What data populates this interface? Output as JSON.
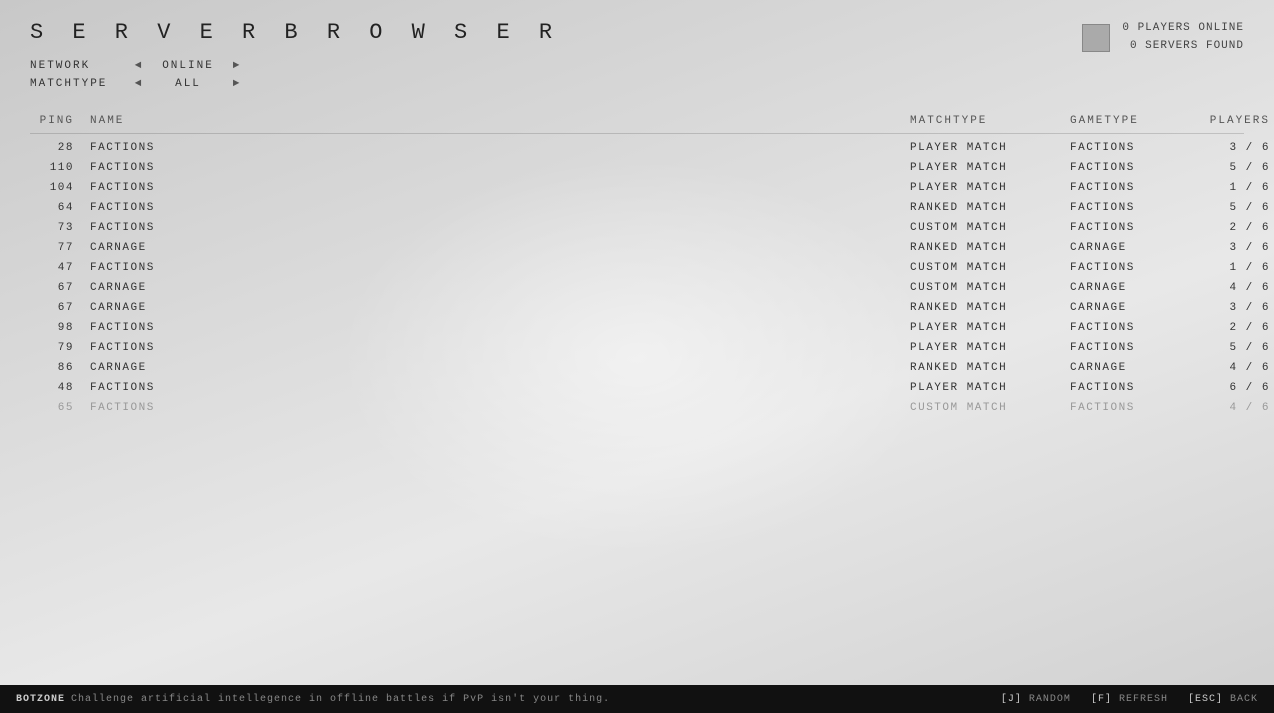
{
  "header": {
    "title": "S E R V E R   B R O W S E R",
    "server_icon_label": "server-icon",
    "players_online": "0 PLAYERS ONLINE",
    "servers_found": "0 SERVERS FOUND"
  },
  "filters": {
    "network_label": "NETWORK",
    "network_value": "ONLINE",
    "matchtype_label": "MATCHTYPE",
    "matchtype_value": "ALL"
  },
  "table": {
    "headers": {
      "ping": "PING",
      "name": "NAME",
      "matchtype": "MATCHTYPE",
      "gametype": "GAMETYPE",
      "players": "PLAYERS"
    },
    "rows": [
      {
        "ping": "28",
        "name": "FACTIONS",
        "matchtype": "PLAYER MATCH",
        "gametype": "FACTIONS",
        "players": "3 / 6",
        "dimmed": false
      },
      {
        "ping": "110",
        "name": "FACTIONS",
        "matchtype": "PLAYER MATCH",
        "gametype": "FACTIONS",
        "players": "5 / 6",
        "dimmed": false
      },
      {
        "ping": "104",
        "name": "FACTIONS",
        "matchtype": "PLAYER MATCH",
        "gametype": "FACTIONS",
        "players": "1 / 6",
        "dimmed": false
      },
      {
        "ping": "64",
        "name": "FACTIONS",
        "matchtype": "RANKED MATCH",
        "gametype": "FACTIONS",
        "players": "5 / 6",
        "dimmed": false
      },
      {
        "ping": "73",
        "name": "FACTIONS",
        "matchtype": "CUSTOM MATCH",
        "gametype": "FACTIONS",
        "players": "2 / 6",
        "dimmed": false
      },
      {
        "ping": "77",
        "name": "CARNAGE",
        "matchtype": "RANKED MATCH",
        "gametype": "CARNAGE",
        "players": "3 / 6",
        "dimmed": false
      },
      {
        "ping": "47",
        "name": "FACTIONS",
        "matchtype": "CUSTOM MATCH",
        "gametype": "FACTIONS",
        "players": "1 / 6",
        "dimmed": false
      },
      {
        "ping": "67",
        "name": "CARNAGE",
        "matchtype": "CUSTOM MATCH",
        "gametype": "CARNAGE",
        "players": "4 / 6",
        "dimmed": false
      },
      {
        "ping": "67",
        "name": "CARNAGE",
        "matchtype": "RANKED MATCH",
        "gametype": "CARNAGE",
        "players": "3 / 6",
        "dimmed": false
      },
      {
        "ping": "98",
        "name": "FACTIONS",
        "matchtype": "PLAYER MATCH",
        "gametype": "FACTIONS",
        "players": "2 / 6",
        "dimmed": false
      },
      {
        "ping": "79",
        "name": "FACTIONS",
        "matchtype": "PLAYER MATCH",
        "gametype": "FACTIONS",
        "players": "5 / 6",
        "dimmed": false
      },
      {
        "ping": "86",
        "name": "CARNAGE",
        "matchtype": "RANKED MATCH",
        "gametype": "CARNAGE",
        "players": "4 / 6",
        "dimmed": false
      },
      {
        "ping": "48",
        "name": "FACTIONS",
        "matchtype": "PLAYER MATCH",
        "gametype": "FACTIONS",
        "players": "6 / 6",
        "dimmed": false
      },
      {
        "ping": "65",
        "name": "FACTIONS",
        "matchtype": "CUSTOM MATCH",
        "gametype": "FACTIONS",
        "players": "4 / 6",
        "dimmed": true
      }
    ]
  },
  "bottom_bar": {
    "botzone_label": "BOTZONE",
    "botzone_desc": "Challenge artificial intellegence in offline battles if PvP isn't your thing.",
    "keybinds": [
      {
        "key": "[J]",
        "action": "RANDOM"
      },
      {
        "key": "[F]",
        "action": "REFRESH"
      },
      {
        "key": "[ESC]",
        "action": "BACK"
      }
    ]
  }
}
